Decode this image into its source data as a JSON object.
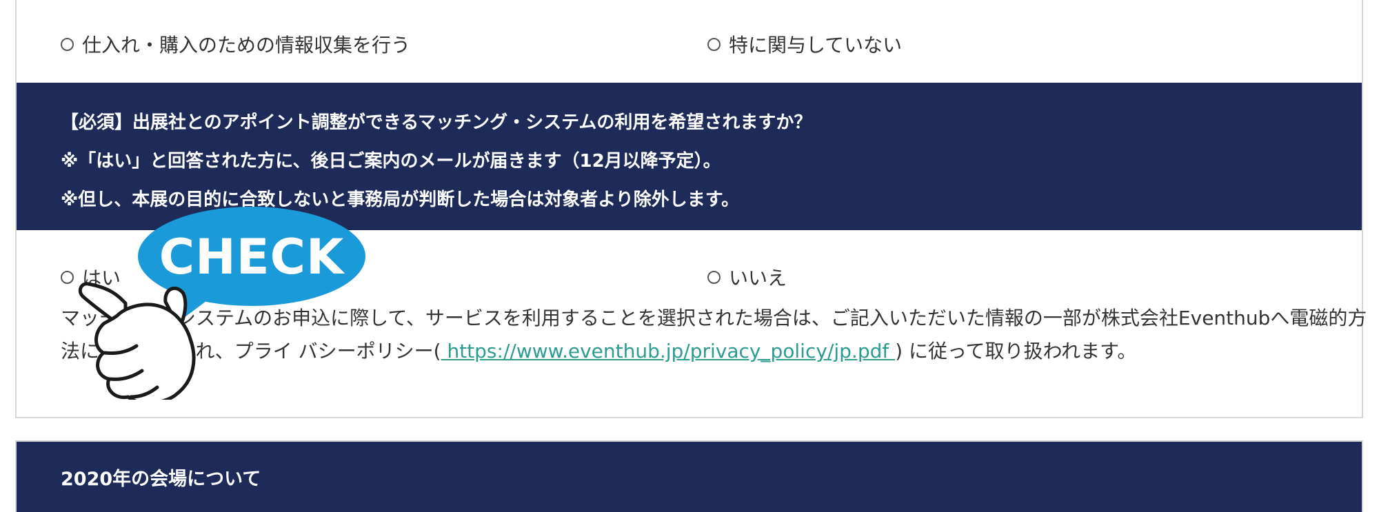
{
  "top_options": {
    "left_label": "仕入れ・購入のための情報収集を行う",
    "right_label": "特に関与していない"
  },
  "question": {
    "line1": "【必須】出展社とのアポイント調整ができるマッチング・システムの利用を希望されますか？",
    "line2": "※「はい」と回答された方に、後日ご案内のメールが届きます（12月以降予定）。",
    "line3": "※但し、本展の目的に合致しないと事務局が判断した場合は対象者より除外します。"
  },
  "answer_options": {
    "yes_label": "はい",
    "no_label": "いいえ"
  },
  "note": {
    "text_part1": "マッチング・システムのお申込に際して、サービスを利用することを選択された場合は、ご記入いただいた情報の一部が株式会社Eventhubへ電磁的方法により送信され、プライ バシーポリシー(",
    "link_text": " https://www.eventhub.jp/privacy_policy/jp.pdf ",
    "text_part2": ") に従って取り扱われます。"
  },
  "overlay": {
    "check_label": "CHECK",
    "bubble_color": "#1a9ad9",
    "icon": "pointing-hand-icon"
  },
  "section2": {
    "title": "2020年の会場について"
  },
  "colors": {
    "header_bg": "#1e2a58",
    "link": "#2a9d8f"
  }
}
